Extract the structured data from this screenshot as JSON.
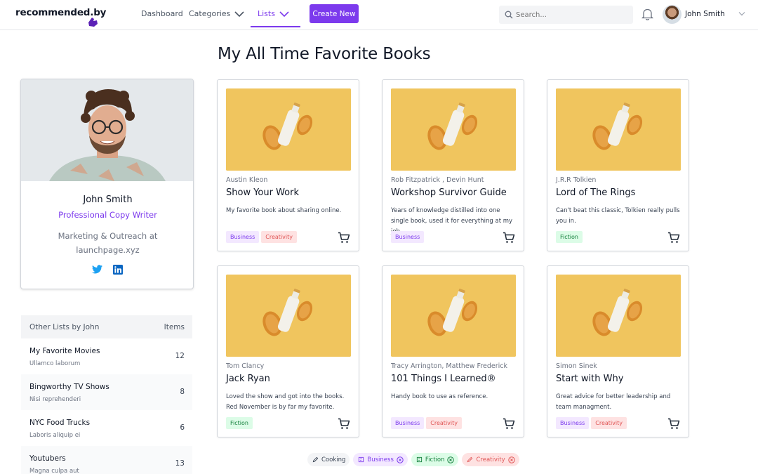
{
  "brand": {
    "name": "recommended.by"
  },
  "nav": {
    "items": [
      {
        "label": "Dashboard"
      },
      {
        "label": "Categories"
      },
      {
        "label": "Lists"
      }
    ],
    "create_label": "Create New"
  },
  "search": {
    "placeholder": "Search..."
  },
  "user": {
    "name": "John Smith"
  },
  "page": {
    "title": "My All Time Favorite Books"
  },
  "profile": {
    "name": "John Smith",
    "role": "Professional Copy Writer",
    "org": "Marketing & Outreach at launchpage.xyz",
    "social": [
      "twitter-icon",
      "linkedin-icon"
    ]
  },
  "other_lists": {
    "header": "Other Lists by John",
    "items_label": "Items",
    "rows": [
      {
        "title": "My Favorite Movies",
        "subtitle": "Ullamco laborum",
        "count": "12"
      },
      {
        "title": "Bingworthy TV Shows",
        "subtitle": "Nisi reprehenderi",
        "count": "8"
      },
      {
        "title": "NYC Food Trucks",
        "subtitle": "Laboris aliquip ei",
        "count": "6"
      },
      {
        "title": "Youtubers",
        "subtitle": "Magna culpa aut",
        "count": "13"
      }
    ]
  },
  "books": [
    {
      "author": "Austin Kleon",
      "title": "Show Your Work",
      "description": "My favorite book about sharing online.",
      "tags": [
        "Business",
        "Creativity"
      ]
    },
    {
      "author": "Rob Fitzpatrick , Devin Hunt",
      "title": "Workshop Survivor Guide",
      "description": "Years of knowledge distilled into one single book, used it for everything at my job.",
      "tags": [
        "Business"
      ]
    },
    {
      "author": "J.R.R Tolkien",
      "title": "Lord of The Rings",
      "description": "Can't beat this classic, Tolkien really pulls you in.",
      "tags": [
        "Fiction"
      ]
    },
    {
      "author": "Tom Clancy",
      "title": "Jack Ryan",
      "description": "Loved the show and got into the books. Red November is by far my favorite.",
      "tags": [
        "Fiction"
      ]
    },
    {
      "author": "Tracy Arrington, Matthew Frederick",
      "title": "101 Things I Learned®",
      "description": "Handy book to use as reference.",
      "tags": [
        "Business",
        "Creativity"
      ]
    },
    {
      "author": "Simon Sinek",
      "title": "Start with Why",
      "description": "Great advice for better leadership and team managment.",
      "tags": [
        "Business",
        "Creativity"
      ]
    }
  ],
  "filters": [
    {
      "label": "Cooking",
      "removable": false
    },
    {
      "label": "Business",
      "removable": true
    },
    {
      "label": "Fiction",
      "removable": true
    },
    {
      "label": "Creativity",
      "removable": true
    }
  ],
  "colors": {
    "accent": "#7c3aed",
    "business": "#7c3aed",
    "creativity": "#e05555",
    "fiction": "#15803d",
    "card_image": "#f0c55e"
  }
}
